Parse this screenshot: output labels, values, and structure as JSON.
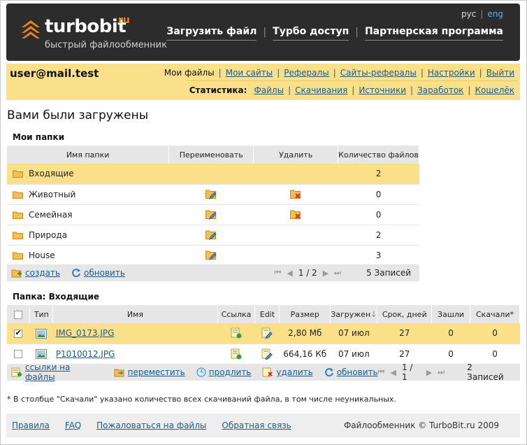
{
  "header": {
    "logo_main": "turbobit",
    "logo_suffix": "ru",
    "logo_tagline": "быстрый файлообменник",
    "lang": {
      "ru": "рус",
      "en": "eng"
    },
    "nav": [
      "Загрузить файл",
      "Турбо доступ",
      "Партнерская программа"
    ]
  },
  "userbar": {
    "email": "user@mail.test",
    "account_nav": [
      "Мои файлы",
      "Мои сайты",
      "Рефералы",
      "Сайты-рефералы",
      "Настройки",
      "Выйти"
    ],
    "stats_label": "Статистика:",
    "stats_nav": [
      "Файлы",
      "Скачивания",
      "Источники",
      "Заработок",
      "Кошелёк"
    ]
  },
  "page_title": "Вами были загружены",
  "folders": {
    "title": "Мои папки",
    "columns": [
      "Имя папки",
      "Переименовать",
      "Удалить",
      "Количество файлов"
    ],
    "rows": [
      {
        "name": "Входящие",
        "count": "2",
        "selected": true,
        "rename": false,
        "delete": false
      },
      {
        "name": "Животный",
        "count": "0",
        "selected": false,
        "rename": true,
        "delete": true
      },
      {
        "name": "Семейная",
        "count": "0",
        "selected": false,
        "rename": true,
        "delete": true
      },
      {
        "name": "Природа",
        "count": "2",
        "selected": false,
        "rename": true,
        "delete": false
      },
      {
        "name": "House",
        "count": "3",
        "selected": false,
        "rename": true,
        "delete": false
      }
    ],
    "toolbar": {
      "create": "создать",
      "refresh": "обновить",
      "page": "1 / 2",
      "records": "5 Записей"
    }
  },
  "files": {
    "title": "Папка: Входящие",
    "columns": [
      "Тип",
      "Имя",
      "Ссылка",
      "Edit",
      "Размер",
      "Загружен",
      "Срок, дней",
      "Зашли",
      "Скачали*"
    ],
    "rows": [
      {
        "name": "IMG_0173.JPG",
        "size": "2,80 Мб",
        "uploaded": "07 июл",
        "term": "27",
        "visits": "0",
        "downloads": "0",
        "checked": true
      },
      {
        "name": "P1010012.JPG",
        "size": "664,16 Кб",
        "uploaded": "07 июл",
        "term": "27",
        "visits": "0",
        "downloads": "0",
        "checked": false
      }
    ],
    "toolbar": {
      "links": "ссылки на файлы",
      "move": "переместить",
      "extend": "продлить",
      "delete": "удалить",
      "refresh": "обновить",
      "page": "1 / 1",
      "records": "2 Записей"
    }
  },
  "footnote": "* В столбце \"Скачали\" указано количество всех скачиваний файла, в том числе неуникальных.",
  "footer": {
    "links": [
      "Правила",
      "FAQ",
      "Пожаловаться на файлы",
      "Обратная связь"
    ],
    "copyright": "Файлообменник © TurboBit.ru 2009"
  },
  "colors": {
    "header_bg": "#2c2c2c",
    "accent_yellow": "#fbe08a",
    "link": "#1a5b8f",
    "logo_orange": "#f0801a"
  }
}
